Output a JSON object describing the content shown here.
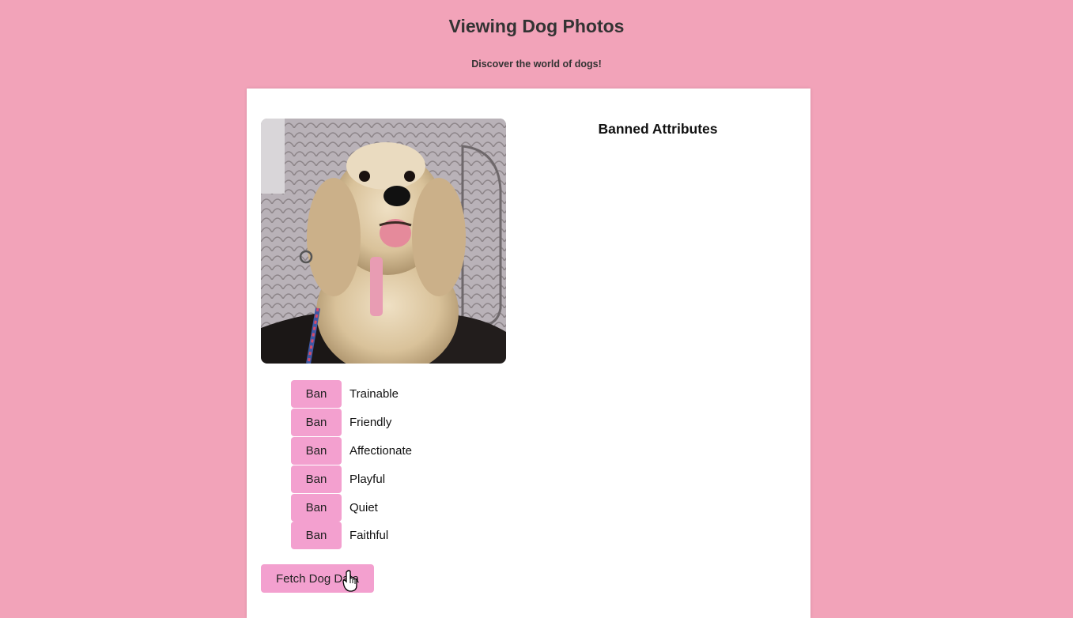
{
  "header": {
    "title": "Viewing Dog Photos",
    "subtitle": "Discover the world of dogs!"
  },
  "colors": {
    "page_background": "#f2a3b9",
    "button_background": "#f3a0cf",
    "card_background": "#ffffff"
  },
  "photo": {
    "icon": "dog-photo"
  },
  "banned": {
    "title": "Banned Attributes",
    "items": []
  },
  "attributes": [
    {
      "button_label": "Ban",
      "label": "Trainable"
    },
    {
      "button_label": "Ban",
      "label": "Friendly"
    },
    {
      "button_label": "Ban",
      "label": "Affectionate"
    },
    {
      "button_label": "Ban",
      "label": "Playful"
    },
    {
      "button_label": "Ban",
      "label": "Quiet"
    },
    {
      "button_label": "Ban",
      "label": "Faithful"
    }
  ],
  "fetch_button": {
    "label": "Fetch Dog Data"
  },
  "cursor": {
    "icon": "hand-pointer-icon"
  }
}
